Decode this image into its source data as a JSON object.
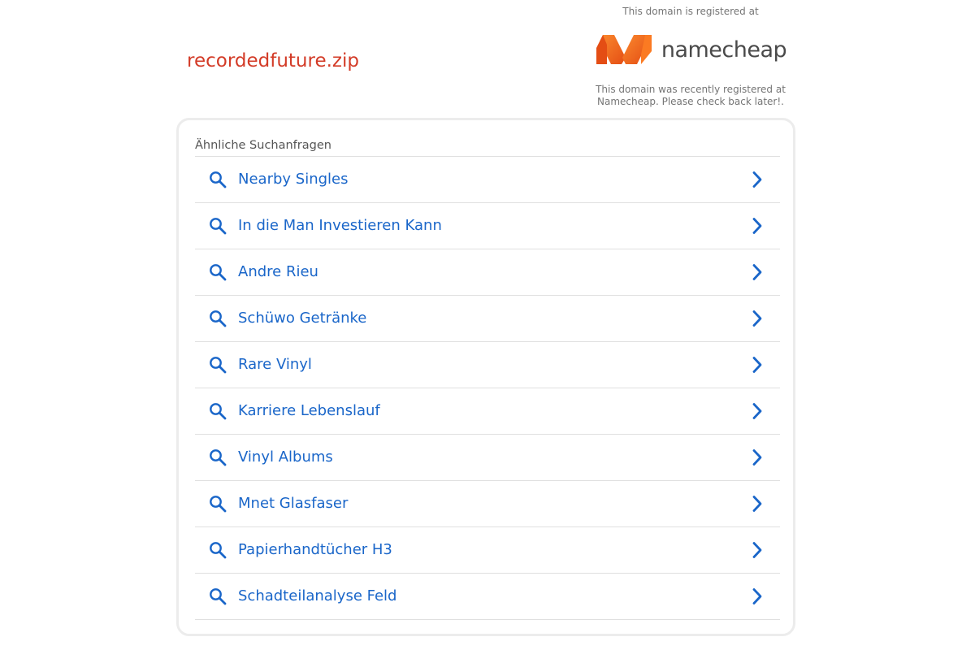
{
  "header": {
    "domain": "recordedfuture.zip"
  },
  "registrar": {
    "top_text": "This domain is registered at",
    "logo_text": "namecheap",
    "bottom_text": "This domain was recently registered at Namecheap. Please check back later!.",
    "logo_colors": [
      "#f26b21",
      "#e8541a"
    ]
  },
  "panel": {
    "heading": "Ähnliche Suchanfragen",
    "items": [
      {
        "label": "Nearby Singles",
        "icon": "search-icon"
      },
      {
        "label": "In die Man Investieren Kann",
        "icon": "search-icon"
      },
      {
        "label": "Andre Rieu",
        "icon": "search-icon"
      },
      {
        "label": "Schüwo Getränke",
        "icon": "search-icon"
      },
      {
        "label": "Rare Vinyl",
        "icon": "search-icon"
      },
      {
        "label": "Karriere Lebenslauf",
        "icon": "search-icon"
      },
      {
        "label": "Vinyl Albums",
        "icon": "search-icon"
      },
      {
        "label": "Mnet Glasfaser",
        "icon": "search-icon"
      },
      {
        "label": "Papierhandtücher H3",
        "icon": "search-icon"
      },
      {
        "label": "Schadteilanalyse Feld",
        "icon": "search-icon"
      }
    ]
  },
  "colors": {
    "domain": "#d33b27",
    "link": "#1a66c9",
    "muted": "#757575"
  }
}
